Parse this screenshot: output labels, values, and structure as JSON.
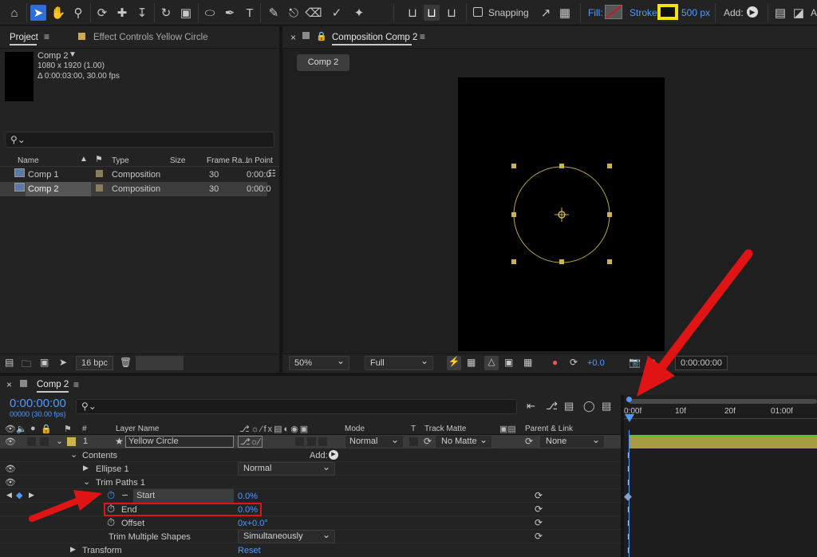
{
  "toolbar": {
    "snapping_label": "Snapping",
    "fill_label": "Fill:",
    "stroke_label": "Stroke:",
    "stroke_width": "500 px",
    "add_label": "Add:",
    "stroke_color": "#f2e600",
    "fill_color": "#c41d1d",
    "icons": [
      "home-icon",
      "selection-icon",
      "hand-icon",
      "zoom-icon",
      "orbit-icon",
      "pan-behind-icon",
      "dolly-icon",
      "rotate-icon",
      "anchor-icon",
      "ellipse-icon",
      "pen-icon",
      "text-icon",
      "brush-icon",
      "clone-stamp-icon",
      "eraser-icon",
      "roto-brush-icon",
      "puppet-icon"
    ]
  },
  "project": {
    "tab_label": "Project",
    "effect_controls_label": "Effect Controls Yellow Circle",
    "comp_name": "Comp 2",
    "comp_size": "1080 x 1920 (1.00)",
    "comp_duration": "Δ 0:00:03:00, 30.00 fps",
    "columns": [
      "Name",
      "Type",
      "Size",
      "Frame Ra...",
      "In Point"
    ],
    "items": [
      {
        "name": "Comp 1",
        "type": "Composition",
        "frame_rate": "30",
        "in_point": "0:00:0"
      },
      {
        "name": "Comp 2",
        "type": "Composition",
        "frame_rate": "30",
        "in_point": "0:00:0"
      }
    ],
    "bpc_label": "16 bpc"
  },
  "composition": {
    "tab_label": "Composition Comp 2",
    "sub_tab": "Comp 2",
    "zoom": "50%",
    "resolution": "Full",
    "exposure": "+0.0",
    "timecode": "0:00:00:00"
  },
  "timeline": {
    "tab_label": "Comp 2",
    "timecode": "0:00:00:00",
    "frame_info": "00000 (30.00 fps)",
    "columns": {
      "num": "#",
      "layer_name": "Layer Name",
      "mode": "Mode",
      "t": "T",
      "track_matte": "Track Matte",
      "parent": "Parent & Link"
    },
    "ruler": [
      "0:00f",
      "10f",
      "20f",
      "01:00f"
    ],
    "layer": {
      "num": "1",
      "name": "Yellow Circle",
      "mode": "Normal",
      "matte": "No Matte",
      "parent": "None"
    },
    "contents_label": "Contents",
    "add_label": "Add:",
    "ellipse_label": "Ellipse 1",
    "ellipse_mode": "Normal",
    "trim_label": "Trim Paths 1",
    "start_label": "Start",
    "start_value": "0.0%",
    "end_label": "End",
    "end_value": "0.0%",
    "offset_label": "Offset",
    "offset_value": "0x+0.0°",
    "trim_multiple_label": "Trim Multiple Shapes",
    "trim_multiple_value": "Simultaneously",
    "transform_label": "Transform",
    "reset_label": "Reset"
  },
  "colors": {
    "accent_blue": "#4d9bff",
    "layer_bar": "#a89a42",
    "annotation_red": "#e01414",
    "circle_stroke": "#b8a542"
  }
}
